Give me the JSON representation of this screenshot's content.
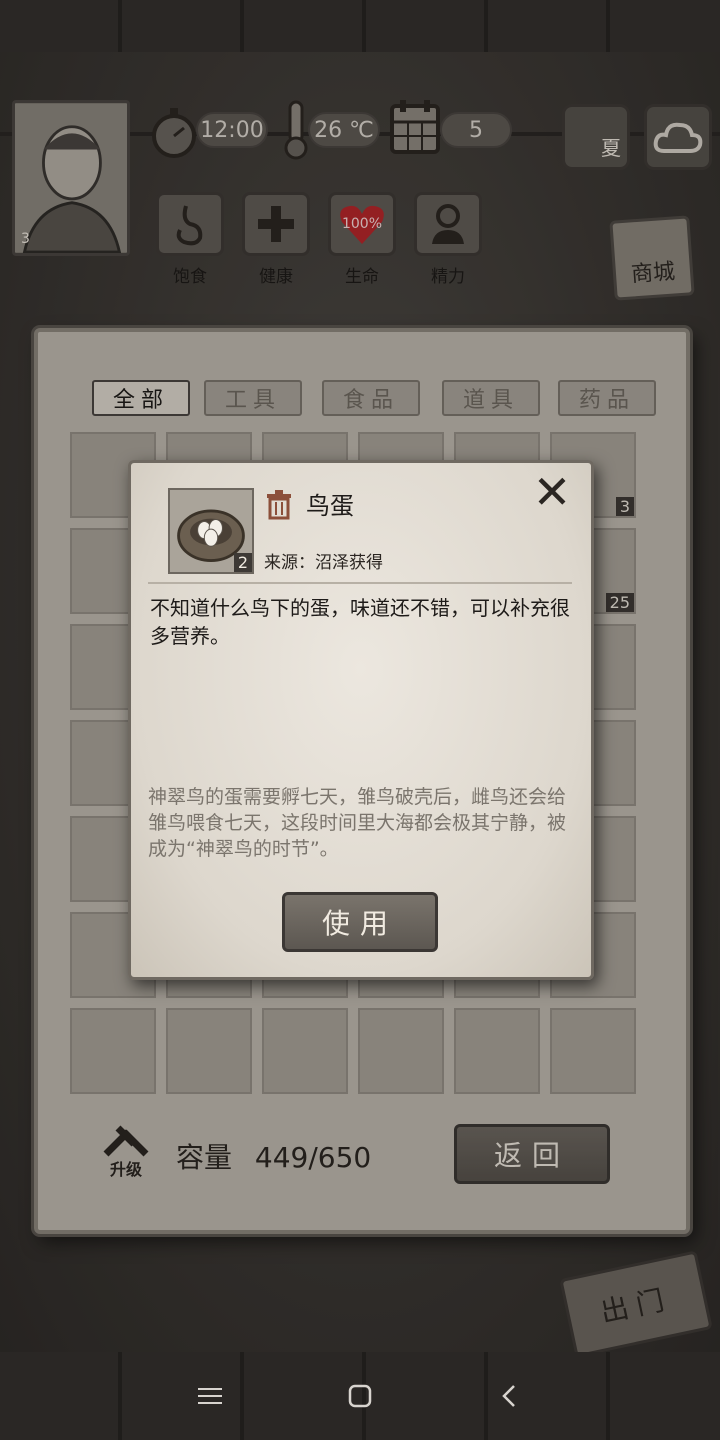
{
  "hud": {
    "level": "3",
    "time": "12:00",
    "temperature": "26 ℃",
    "day": "5",
    "season": "夏",
    "stats": [
      {
        "label": "饱食",
        "icon": "stomach-icon"
      },
      {
        "label": "健康",
        "icon": "health-cross-icon"
      },
      {
        "label": "生命",
        "icon": "heart-icon",
        "value": "100%"
      },
      {
        "label": "精力",
        "icon": "stamina-person-icon"
      }
    ],
    "shop_label": "商城",
    "exit_label": "出门"
  },
  "inventory": {
    "tabs": [
      {
        "label": "全部",
        "active": true
      },
      {
        "label": "工具",
        "active": false
      },
      {
        "label": "食品",
        "active": false
      },
      {
        "label": "道具",
        "active": false
      },
      {
        "label": "药品",
        "active": false
      }
    ],
    "visible_counts": {
      "cell_a": "3",
      "cell_b": "25"
    },
    "upgrade_label": "升级",
    "capacity_label": "容量",
    "capacity_value": "449/650",
    "back_label": "返回"
  },
  "item_detail": {
    "name": "鸟蛋",
    "count": "2",
    "source": "来源：沼泽获得",
    "description": "不知道什么鸟下的蛋，味道还不错，可以补充很多营养。",
    "lore": "神翠鸟的蛋需要孵七天，雏鸟破壳后，雌鸟还会给雏鸟喂食七天，这段时间里大海都会极其宁静，被成为“神翠鸟的时节”。",
    "use_label": "使用"
  },
  "colors": {
    "paper": "#ddd7cd",
    "button": "#5c5751",
    "ink": "#1e1b19"
  }
}
